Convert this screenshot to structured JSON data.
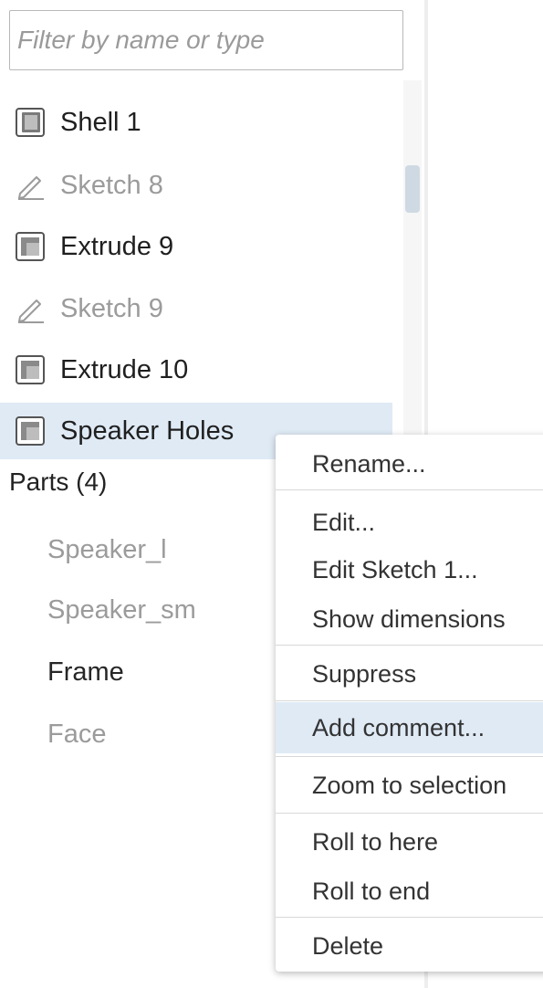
{
  "filter": {
    "placeholder": "Filter by name or type"
  },
  "features": [
    {
      "label": "Shell 1",
      "icon": "shell-feature-icon",
      "state": "active"
    },
    {
      "label": "Sketch 8",
      "icon": "sketch-pencil-icon",
      "state": "rolled"
    },
    {
      "label": "Extrude 9",
      "icon": "extrude-feature-icon",
      "state": "active"
    },
    {
      "label": "Sketch 9",
      "icon": "sketch-pencil-icon",
      "state": "rolled"
    },
    {
      "label": "Extrude 10",
      "icon": "extrude-feature-icon",
      "state": "active"
    },
    {
      "label": "Speaker Holes",
      "icon": "extrude-feature-icon",
      "state": "selected"
    }
  ],
  "parts": {
    "header": "Parts (4)",
    "items": [
      {
        "label": "Speaker_l",
        "state": "dim"
      },
      {
        "label": "Speaker_sm",
        "state": "dim"
      },
      {
        "label": "Frame",
        "state": "on"
      },
      {
        "label": "Face",
        "state": "dim"
      }
    ]
  },
  "context_menu": {
    "items": [
      {
        "label": "Rename..."
      },
      {
        "label": "Edit..."
      },
      {
        "label": "Edit Sketch 1..."
      },
      {
        "label": "Show dimensions"
      },
      {
        "label": "Suppress"
      },
      {
        "label": "Add comment...",
        "highlighted": true
      },
      {
        "label": "Zoom to selection"
      },
      {
        "label": "Roll to here"
      },
      {
        "label": "Roll to end"
      },
      {
        "label": "Delete"
      }
    ]
  },
  "colors": {
    "selection": "#dfeaf5",
    "rolled_text": "#9b9b9b",
    "active_text": "#1f1f1f"
  }
}
